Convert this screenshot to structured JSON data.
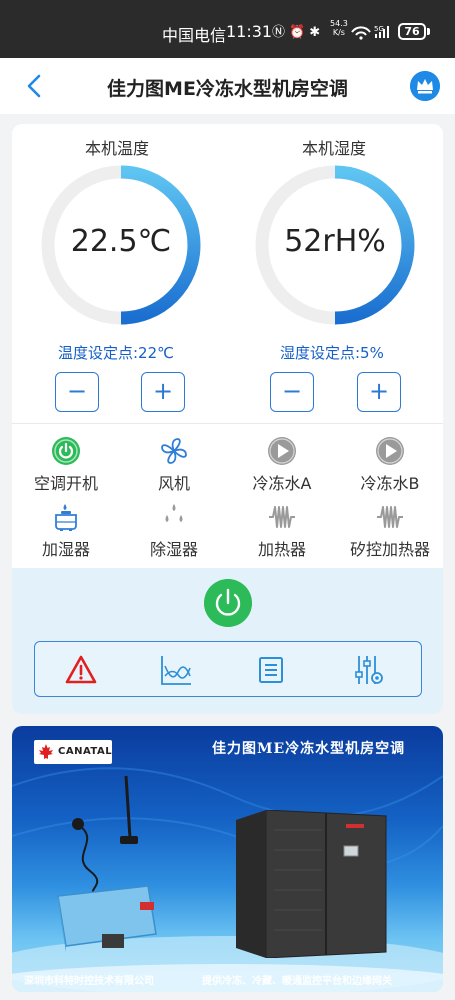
{
  "status_bar": {
    "carrier": "中国电信",
    "time": "11:31",
    "speed_top": "54.3",
    "speed_bottom": "K/s",
    "battery": "76"
  },
  "header": {
    "title": "佳力图ME冷冻水型机房空调"
  },
  "gauges": [
    {
      "title": "本机温度",
      "value": "22.5℃",
      "setpoint": "温度设定点:22℃",
      "level": 0.5
    },
    {
      "title": "本机湿度",
      "value": "52rH%",
      "setpoint": "湿度设定点:5%",
      "level": 0.5
    }
  ],
  "controls": {
    "minus": "−",
    "plus": "+"
  },
  "devices": [
    {
      "label": "空调开机",
      "icon": "power-on-icon"
    },
    {
      "label": "风机",
      "icon": "fan-icon"
    },
    {
      "label": "冷冻水A",
      "icon": "play-icon"
    },
    {
      "label": "冷冻水B",
      "icon": "play-icon"
    },
    {
      "label": "加湿器",
      "icon": "humidifier-icon"
    },
    {
      "label": "除湿器",
      "icon": "dehumidifier-icon"
    },
    {
      "label": "加热器",
      "icon": "heater-icon"
    },
    {
      "label": "矽控加热器",
      "icon": "heater-icon"
    }
  ],
  "toolbar": {
    "items": [
      "alarm-icon",
      "trend-chart-icon",
      "list-icon",
      "settings-icon"
    ]
  },
  "banner": {
    "brand": "CANATAL",
    "title": "佳力图ME冷冻水型机房空调",
    "footer_left": "深圳市科特时控技术有限公司",
    "footer_right": "提供冷冻、冷藏、暖通监控平台和边缘网关"
  },
  "colors": {
    "accent": "#2d7ad6",
    "gauge_gradient_start": "#1b6fd0",
    "gauge_gradient_end": "#5ec4f2",
    "power_on": "#2dbb5a",
    "alarm": "#e02020",
    "panel_bg": "#e3f1fb"
  }
}
